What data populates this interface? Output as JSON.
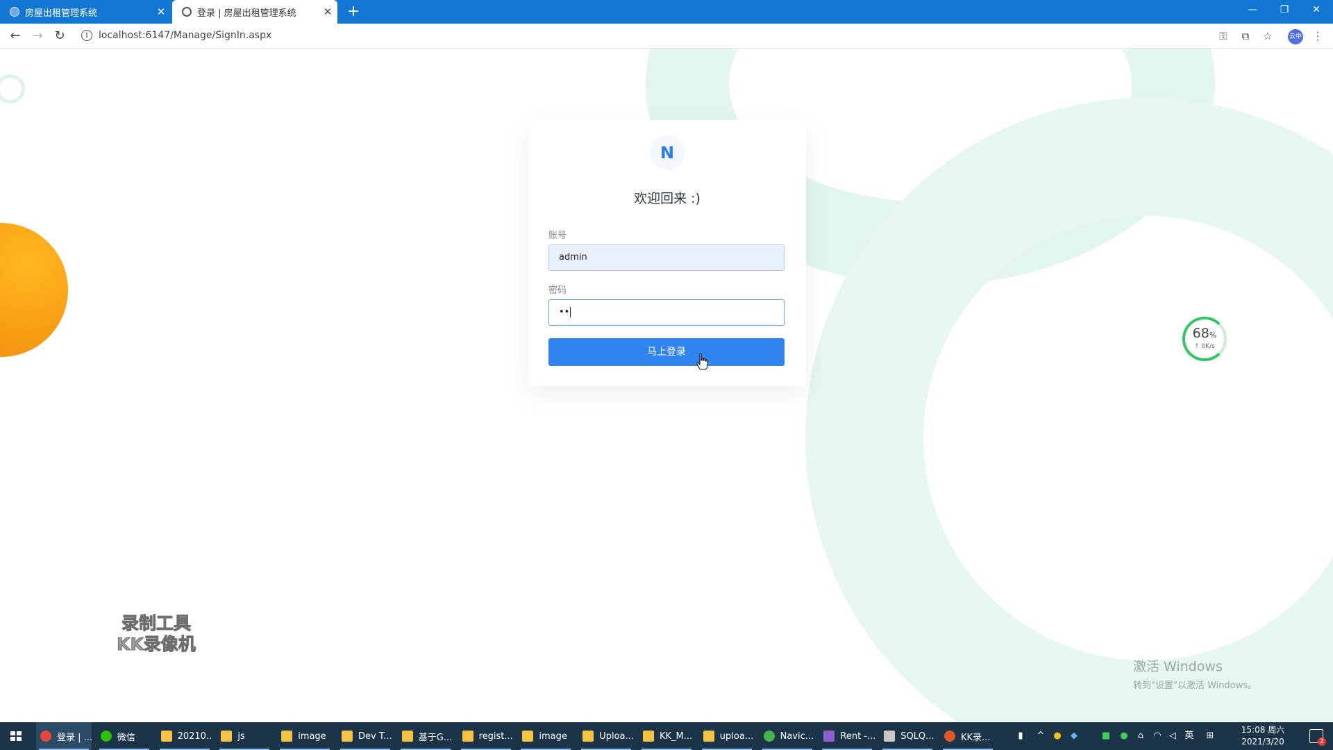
{
  "browser": {
    "tabs": [
      {
        "title": "房屋出租管理系统",
        "active": false
      },
      {
        "title": "登录 | 房屋出租管理系统",
        "active": true
      }
    ],
    "new_tab": "+",
    "url": "localhost:6147/Manage/SignIn.aspx",
    "icons": {
      "back": "back-arrow-icon",
      "forward": "forward-arrow-icon",
      "reload": "reload-icon",
      "info": "info-icon",
      "key": "key-icon",
      "translate": "translate-icon",
      "star": "star-icon",
      "menu": "kebab-menu-icon"
    },
    "profile_label": "云中"
  },
  "login": {
    "logo_letter": "N",
    "heading": "欢迎回来 :)",
    "account_label": "账号",
    "account_value": "admin",
    "password_label": "密码",
    "password_value": "••",
    "submit_label": "马上登录"
  },
  "speed_widget": {
    "percent": "68",
    "percent_unit": "%",
    "rate": "↑ 0K/s"
  },
  "watermark": {
    "line1": "录制工具",
    "line2": "KK录像机"
  },
  "windows_activation": {
    "line1": "激活 Windows",
    "line2": "转到\"设置\"以激活 Windows。"
  },
  "taskbar": {
    "apps": [
      {
        "label": "登录 | ...",
        "icon": "chrome-icon",
        "color": "#e8453c",
        "active": true
      },
      {
        "label": "微信",
        "icon": "wechat-icon",
        "color": "#2dc100",
        "active": false
      },
      {
        "label": "20210...",
        "icon": "folder-icon",
        "color": "#f5c342",
        "active": false
      },
      {
        "label": "js",
        "icon": "folder-icon",
        "color": "#f5c342",
        "active": false
      },
      {
        "label": "image",
        "icon": "folder-icon",
        "color": "#f5c342",
        "active": false
      },
      {
        "label": "Dev T...",
        "icon": "folder-icon",
        "color": "#f5c342",
        "active": false
      },
      {
        "label": "基于G...",
        "icon": "folder-icon",
        "color": "#f5c342",
        "active": false
      },
      {
        "label": "regist...",
        "icon": "folder-icon",
        "color": "#f5c342",
        "active": false
      },
      {
        "label": "image",
        "icon": "folder-icon",
        "color": "#f5c342",
        "active": false
      },
      {
        "label": "Uploa...",
        "icon": "folder-icon",
        "color": "#f5c342",
        "active": false
      },
      {
        "label": "KK_M...",
        "icon": "folder-icon",
        "color": "#f5c342",
        "active": false
      },
      {
        "label": "uploa...",
        "icon": "folder-icon",
        "color": "#f5c342",
        "active": false
      },
      {
        "label": "Navic...",
        "icon": "navicat-icon",
        "color": "#49b549",
        "active": false
      },
      {
        "label": "Rent -...",
        "icon": "visual-studio-icon",
        "color": "#8e5fd1",
        "active": false
      },
      {
        "label": "SQLQ...",
        "icon": "sql-server-icon",
        "color": "#c8c8c8",
        "active": false
      },
      {
        "label": "KK录...",
        "icon": "kk-recorder-icon",
        "color": "#e0582a",
        "active": false
      }
    ],
    "tray": {
      "ime": "英",
      "keyboard": "⊞"
    },
    "clock": {
      "time": "15:08 周六",
      "date": "2021/3/20"
    },
    "notification_count": "2"
  }
}
